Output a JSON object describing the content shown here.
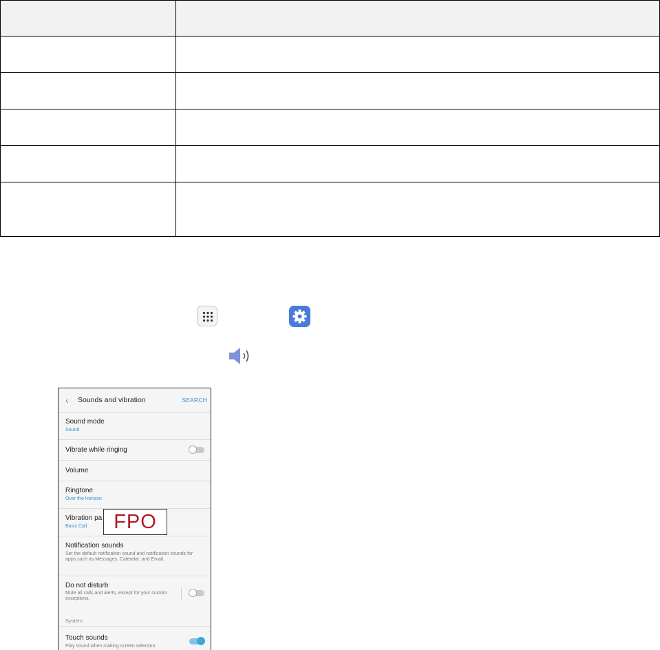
{
  "colors": {
    "accent": "#3d8fc9",
    "fpo_red": "#b2182b",
    "settings_blue": "#4a7bd8"
  },
  "icons": [
    "apps-icon",
    "settings-icon",
    "sound-volume-icon",
    "back-chevron-icon"
  ],
  "phone": {
    "title": "Sounds and vibration",
    "search_label": "SEARCH",
    "items": {
      "sound_mode": {
        "title": "Sound mode",
        "value": "Sound"
      },
      "vibrate_while_ringing": {
        "title": "Vibrate while ringing",
        "toggle": "off"
      },
      "volume": {
        "title": "Volume"
      },
      "ringtone": {
        "title": "Ringtone",
        "value": "Over the Horizon"
      },
      "vibration_pattern": {
        "title": "Vibration pa",
        "value": "Basic Call"
      },
      "notification_sounds": {
        "title": "Notification sounds",
        "desc": "Set the default notification sound and notification sounds for apps such as Messages, Calendar, and Email."
      },
      "do_not_disturb": {
        "title": "Do not disturb",
        "desc": "Mute all calls and alerts, except for your custom exceptions.",
        "toggle": "off"
      },
      "system_section": "System",
      "touch_sounds": {
        "title": "Touch sounds",
        "desc": "Play sound when making screen selection.",
        "toggle": "on"
      }
    },
    "fpo_label": "FPO"
  }
}
